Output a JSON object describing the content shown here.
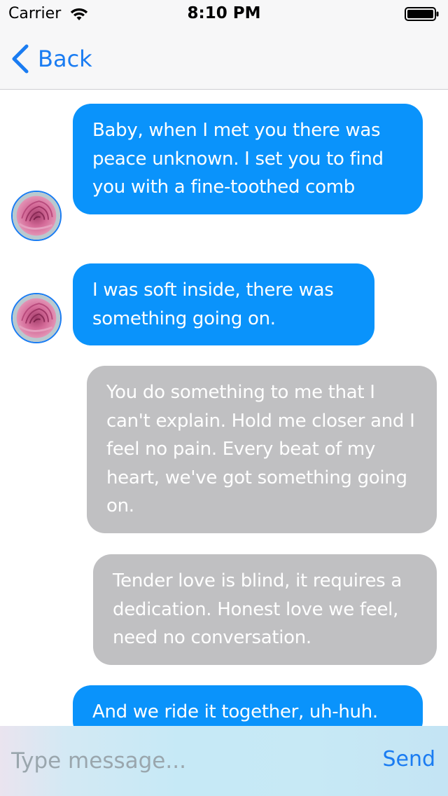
{
  "status_bar": {
    "carrier": "Carrier",
    "time": "8:10 PM",
    "wifi_icon": "wifi-icon",
    "battery_icon": "battery-icon"
  },
  "nav": {
    "back_label": "Back",
    "back_icon": "chevron-left-icon"
  },
  "messages": [
    {
      "sender": "incoming",
      "avatar": "rose-icon",
      "text": "Baby, when I met you there was peace unknown. I set you to find you with a fine-toothed comb"
    },
    {
      "sender": "incoming",
      "avatar": "rose-icon",
      "text": "I was soft inside, there was something going on."
    },
    {
      "sender": "outgoing",
      "text": "You do something to me that I can't explain. Hold me closer and I feel no pain. Every beat of my heart, we've got something going on."
    },
    {
      "sender": "outgoing",
      "text": "Tender love is blind, it requires a dedication. Honest love we feel, need no conversation."
    },
    {
      "sender": "incoming",
      "avatar": "rose-icon",
      "text": "And we ride it together, uh-huh."
    }
  ],
  "composer": {
    "placeholder": "Type message...",
    "value": "",
    "send_label": "Send"
  },
  "colors": {
    "accent": "#1a7cf2",
    "incoming_bubble": "#0a93fb",
    "outgoing_bubble": "#c0c0c2"
  }
}
